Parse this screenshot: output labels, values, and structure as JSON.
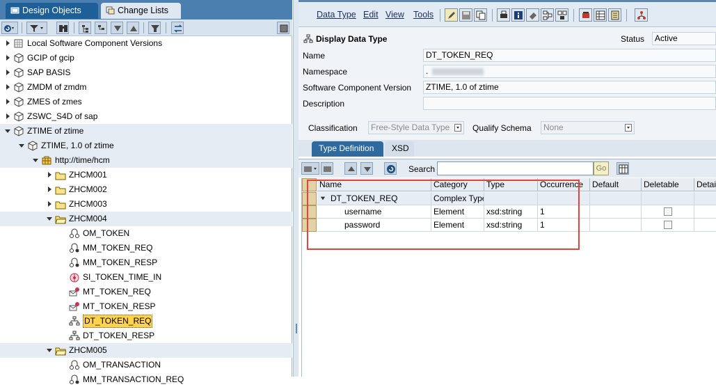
{
  "left_tabs": {
    "design_objects": "Design Objects",
    "change_lists": "Change Lists"
  },
  "tree": [
    {
      "label": "Local Software Component Versions",
      "icon": "grid-icon",
      "arrow": "right"
    },
    {
      "label": "GCIP of gcip",
      "icon": "cube-icon",
      "arrow": "right"
    },
    {
      "label": "SAP BASIS",
      "icon": "cube-icon",
      "arrow": "right"
    },
    {
      "label": "ZMDM of zmdm",
      "icon": "cube-icon",
      "arrow": "right"
    },
    {
      "label": "ZMES of zmes",
      "icon": "cube-icon",
      "arrow": "right"
    },
    {
      "label": "ZSWC_S4D of sap",
      "icon": "cube-icon",
      "arrow": "right"
    },
    {
      "label": "ZTIME of ztime",
      "icon": "cube-icon",
      "arrow": "down"
    },
    {
      "label": "ZTIME, 1.0 of ztime",
      "icon": "cube-open-icon",
      "arrow": "down"
    },
    {
      "label": "http://time/hcm",
      "icon": "namespace-icon",
      "arrow": "down"
    },
    {
      "label": "ZHCM001",
      "icon": "folder-icon",
      "arrow": "right"
    },
    {
      "label": "ZHCM002",
      "icon": "folder-icon",
      "arrow": "right"
    },
    {
      "label": "ZHCM003",
      "icon": "folder-icon",
      "arrow": "right"
    },
    {
      "label": "ZHCM004",
      "icon": "folder-open-icon",
      "arrow": "down"
    },
    {
      "label": "OM_TOKEN",
      "icon": "operation-mapping-icon",
      "arrow": ""
    },
    {
      "label": "MM_TOKEN_REQ",
      "icon": "message-mapping-icon",
      "arrow": ""
    },
    {
      "label": "MM_TOKEN_RESP",
      "icon": "message-mapping-icon",
      "arrow": ""
    },
    {
      "label": "SI_TOKEN_TIME_IN",
      "icon": "service-interface-icon",
      "arrow": ""
    },
    {
      "label": "MT_TOKEN_REQ",
      "icon": "message-type-icon",
      "arrow": ""
    },
    {
      "label": "MT_TOKEN_RESP",
      "icon": "message-type-icon",
      "arrow": ""
    },
    {
      "label": "DT_TOKEN_REQ",
      "icon": "data-type-icon",
      "arrow": "",
      "selected": true
    },
    {
      "label": "DT_TOKEN_RESP",
      "icon": "data-type-icon",
      "arrow": ""
    },
    {
      "label": "ZHCM005",
      "icon": "folder-open-icon",
      "arrow": "down"
    },
    {
      "label": "OM_TRANSACTION",
      "icon": "operation-mapping-icon",
      "arrow": ""
    },
    {
      "label": "MM_TRANSACTION_REQ",
      "icon": "message-mapping-icon",
      "arrow": ""
    }
  ],
  "menu": {
    "data_type": "Data Type",
    "edit": "Edit",
    "view": "View",
    "tools": "Tools"
  },
  "form": {
    "title": "Display Data Type",
    "status_label": "Status",
    "status_value": "Active",
    "name_label": "Name",
    "name_value": "DT_TOKEN_REQ",
    "namespace_label": "Namespace",
    "namespace_value": ".",
    "swcv_label": "Software Component Version",
    "swcv_value": "ZTIME, 1.0 of ztime",
    "description_label": "Description",
    "description_value": "",
    "classification_label": "Classification",
    "classification_value": "Free-Style Data Type",
    "qualify_schema_label": "Qualify Schema",
    "qualify_schema_value": "None"
  },
  "type_tabs": {
    "type_definition": "Type Definition",
    "xsd": "XSD"
  },
  "search": {
    "label": "Search",
    "value": "",
    "go_label": "Go"
  },
  "grid": {
    "headers": [
      "Name",
      "Category",
      "Type",
      "Occurrence",
      "Default",
      "Deletable",
      "Detai"
    ],
    "rows": [
      {
        "name": "DT_TOKEN_REQ",
        "category": "Complex Type",
        "type": "",
        "occurrence": "",
        "default": "",
        "deletable": null
      },
      {
        "name": "username",
        "category": "Element",
        "type": "xsd:string",
        "occurrence": "1",
        "default": "",
        "deletable": false
      },
      {
        "name": "password",
        "category": "Element",
        "type": "xsd:string",
        "occurrence": "1",
        "default": "",
        "deletable": false
      }
    ]
  }
}
